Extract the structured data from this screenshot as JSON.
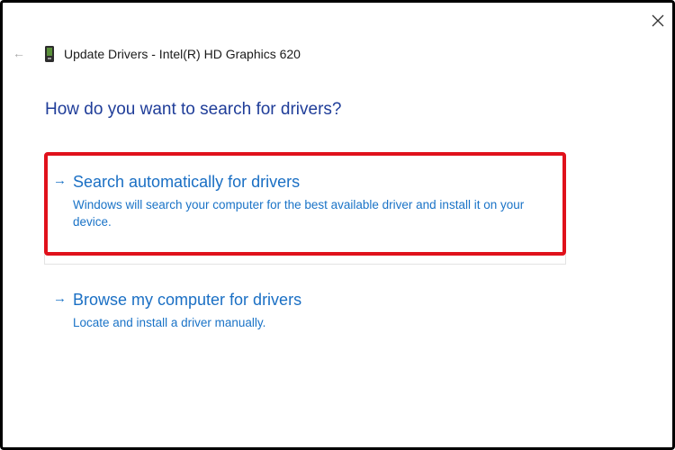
{
  "window": {
    "title": "Update Drivers - Intel(R) HD Graphics 620",
    "back_glyph": "←",
    "close_icon": "close-icon"
  },
  "content": {
    "heading": "How do you want to search for drivers?",
    "options": [
      {
        "arrow": "→",
        "title": "Search automatically for drivers",
        "description": "Windows will search your computer for the best available driver and install it on your device.",
        "highlight_color": "#e0111b"
      },
      {
        "arrow": "→",
        "title": "Browse my computer for drivers",
        "description": "Locate and install a driver manually."
      }
    ]
  },
  "colors": {
    "heading": "#1f3d99",
    "link": "#1a6fc4",
    "frame": "#000000"
  }
}
